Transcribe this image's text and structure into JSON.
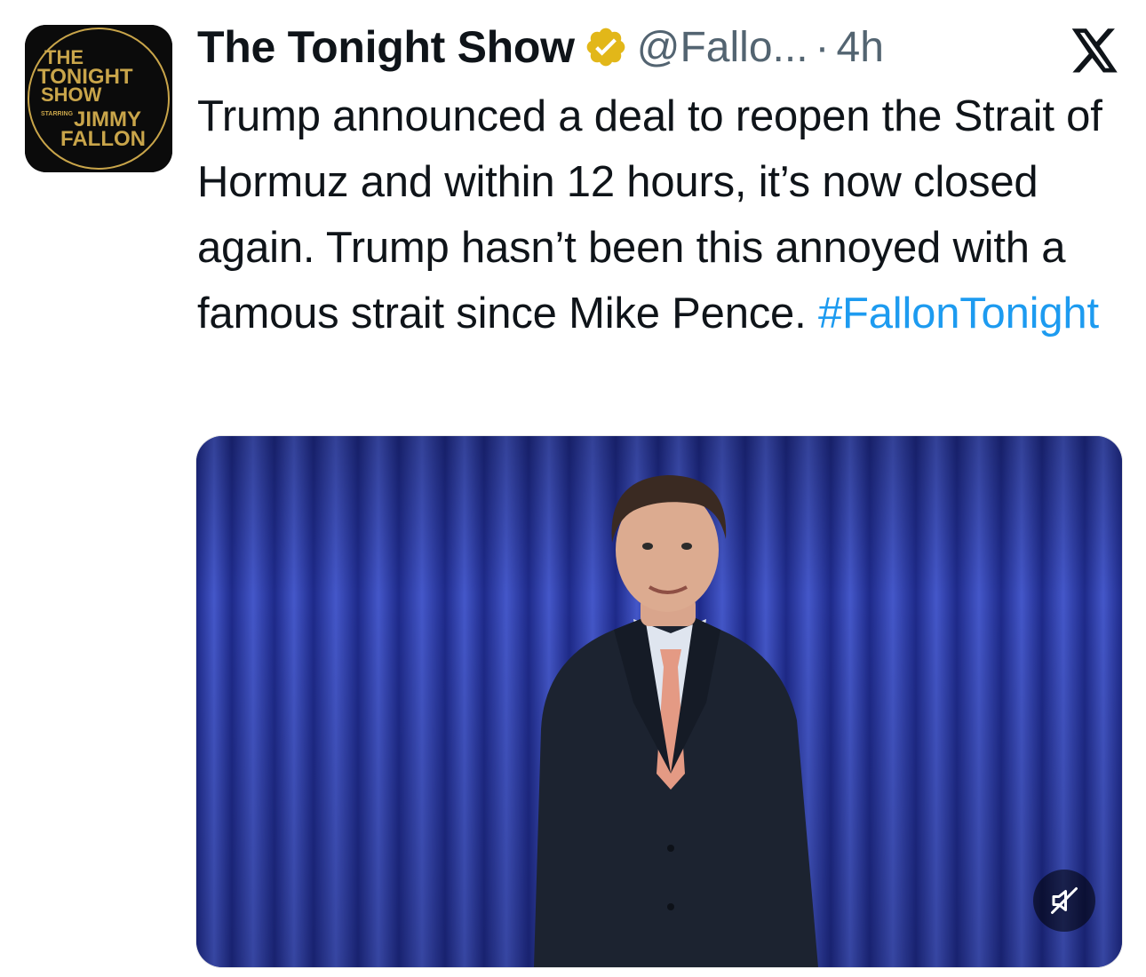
{
  "post": {
    "author_name": "The Tonight Show",
    "handle": "@Fallo...",
    "separator": "·",
    "time": "4h",
    "text_main": "Trump announced a deal to reopen the Strait of Hormuz and within 12 hours, it’s now closed again. Trump hasn’t been this annoyed with a famous strait since Mike Pence. ",
    "hashtag": "#FallonTonight"
  },
  "avatar": {
    "logo_text": [
      "THE",
      "TONIGHT",
      "SHOW",
      "STARRING",
      "JIMMY",
      "FALLON"
    ]
  },
  "icons": {
    "verified": "verified-badge-icon",
    "platform": "x-logo-icon",
    "mute": "speaker-muted-icon"
  },
  "colors": {
    "text": "#0f1419",
    "secondary": "#536471",
    "link": "#1d9bf0",
    "verified_gold": "#e2b719",
    "curtain_blue": "#3344b0"
  }
}
